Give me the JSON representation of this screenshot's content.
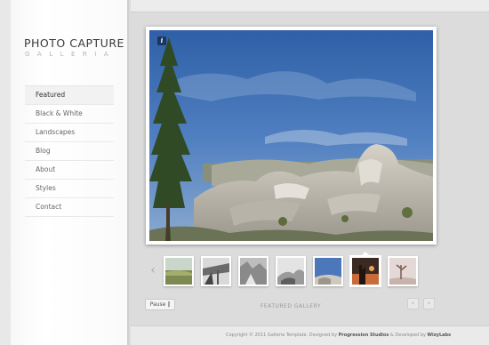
{
  "brand": {
    "title": "PHOTO CAPTURE",
    "subtitle": "GALLERIA"
  },
  "nav": {
    "items": [
      {
        "label": "Featured",
        "active": true
      },
      {
        "label": "Black & White"
      },
      {
        "label": "Landscapes"
      },
      {
        "label": "Blog"
      },
      {
        "label": "About"
      },
      {
        "label": "Styles"
      },
      {
        "label": "Contact"
      }
    ]
  },
  "viewer": {
    "info_icon": "info-icon",
    "info_label": "i"
  },
  "thumbnails": {
    "prev_label": "‹",
    "count": 7,
    "active_index": 5
  },
  "controls": {
    "pause_label": "Pause ‖",
    "gallery_label": "FEATURED GALLERY",
    "prev_label": "‹",
    "next_label": "›"
  },
  "footer": {
    "prefix": "Copyright © 2011 Galleria Template. Designed by ",
    "designer": "Progression Studios",
    "middle": " & Developed by ",
    "developer": "WizyLabs"
  },
  "colors": {
    "background": "#dcdcdc",
    "sidebar": "#ffffff",
    "sky": "#3f6fb3"
  }
}
